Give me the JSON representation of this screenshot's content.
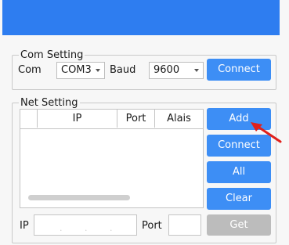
{
  "com_setting": {
    "title": "Com Setting",
    "com_label": "Com",
    "com_value": "COM3",
    "baud_label": "Baud",
    "baud_value": "9600",
    "connect_label": "Connect"
  },
  "net_setting": {
    "title": "Net Setting",
    "table": {
      "columns": [
        "",
        "IP",
        "Port",
        "Alais"
      ],
      "rows": []
    },
    "buttons": {
      "add": "Add",
      "connect": "Connect",
      "all": "All",
      "clear": "Clear",
      "get": "Get"
    },
    "ip_label": "IP",
    "ip_value": "",
    "port_label": "Port",
    "port_value": ""
  },
  "colors": {
    "titlebar": "#2e7df0",
    "button": "#3d8ef5",
    "button_disabled": "#bcbcbc",
    "annotation_arrow": "#e0201b"
  },
  "icons": {
    "dropdown": "chevron-down-icon",
    "annotation": "red-arrow-icon"
  }
}
